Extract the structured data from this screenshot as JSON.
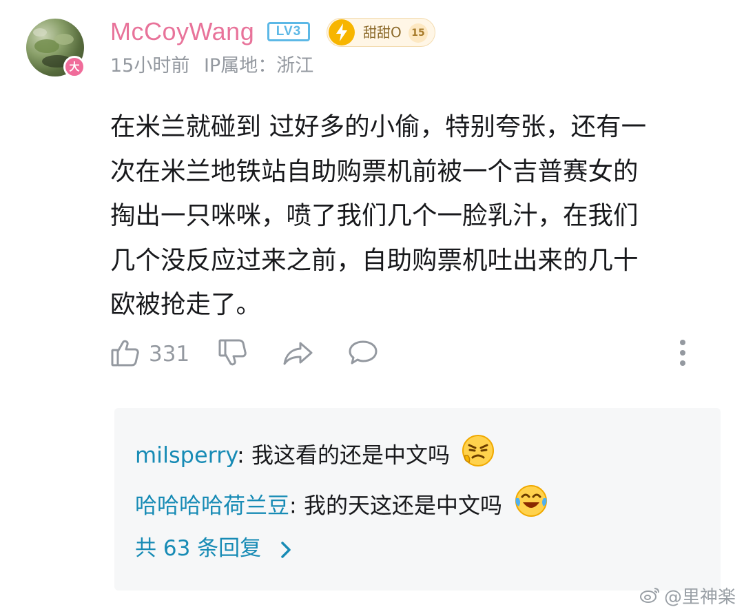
{
  "post": {
    "username": "McCoyWang",
    "level": "LV3",
    "avatar_badge": "大",
    "fan_badge": {
      "name": "甜甜O",
      "level": "15"
    },
    "time": "15小时前",
    "ip_location": "IP属地：浙江",
    "content": "在米兰就碰到 过好多的小偷，特别夸张，还有一\n次在米兰地铁站自助购票机前被一个吉普赛女的\n掏出一只咪咪，喷了我们几个一脸乳汁，在我们\n几个没反应过来之前，自助购票机吐出来的几十\n欧被抢走了。"
  },
  "actions": {
    "like_count": "331",
    "icons": [
      "thumb-up-icon",
      "thumb-down-icon",
      "share-icon",
      "comment-icon",
      "more-icon"
    ]
  },
  "replies": {
    "items": [
      {
        "user": "milsperry",
        "separator": ": ",
        "text": "我这看的还是中文吗",
        "emoji": "angry-face-emoji"
      },
      {
        "user": "哈哈哈哈荷兰豆",
        "separator": ": ",
        "text": "我的天这还是中文吗",
        "emoji": "laughing-crying-emoji"
      }
    ],
    "more_label": "共 63 条回复"
  },
  "watermark": "@里神楽",
  "colors": {
    "username": "#e8739a",
    "link": "#178bb5",
    "meta": "#9499a0",
    "level_badge": "#5cb8e6",
    "reply_bg": "#f6f7f8"
  }
}
